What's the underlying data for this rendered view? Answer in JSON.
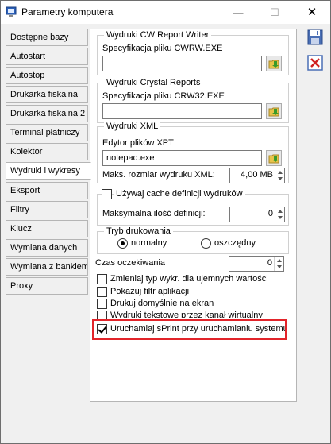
{
  "window": {
    "title": "Parametry komputera"
  },
  "titlebar": {
    "minimize": "—",
    "maximize": "☐",
    "close": "✕"
  },
  "sidebar": {
    "items": [
      {
        "label": "Dostępne bazy"
      },
      {
        "label": "Autostart"
      },
      {
        "label": "Autostop"
      },
      {
        "label": "Drukarka fiskalna"
      },
      {
        "label": "Drukarka fiskalna 2"
      },
      {
        "label": "Terminal płatniczy"
      },
      {
        "label": "Kolektor"
      },
      {
        "label": "Wydruki i wykresy",
        "active": true
      },
      {
        "label": "Eksport"
      },
      {
        "label": "Filtry"
      },
      {
        "label": "Klucz"
      },
      {
        "label": "Wymiana danych"
      },
      {
        "label": "Wymiana z bankiem"
      },
      {
        "label": "Proxy"
      }
    ]
  },
  "cw": {
    "title": "Wydruki CW Report Writer",
    "label": "Specyfikacja pliku CWRW.EXE",
    "value": ""
  },
  "crystal": {
    "title": "Wydruki Crystal Reports",
    "label": "Specyfikacja pliku CRW32.EXE",
    "value": ""
  },
  "xml": {
    "title": "Wydruki XML",
    "editor_label": "Edytor plików XPT",
    "editor_value": "notepad.exe",
    "max_label": "Maks. rozmiar wydruku XML:",
    "max_value": "4,00 MB"
  },
  "cache": {
    "label": "Używaj cache definicji wydruków",
    "checked": false,
    "max_label": "Maksymalna ilość definicji:",
    "max_value": "0"
  },
  "mode": {
    "title": "Tryb drukowania",
    "normal": "normalny",
    "saving": "oszczędny",
    "selected": "normalny"
  },
  "timeout": {
    "label": "Czas oczekiwania",
    "value": "0"
  },
  "options": [
    {
      "label": "Zmieniaj typ wykr. dla ujemnych wartości",
      "checked": false
    },
    {
      "label": "Pokazuj filtr aplikacji",
      "checked": false
    },
    {
      "label": "Drukuj domyślnie na ekran",
      "checked": false
    },
    {
      "label": "Wydruki tekstowe przez kanał wirtualny",
      "checked": false
    },
    {
      "label": "Uruchamiaj sPrint przy uruchamianiu systemu",
      "checked": true
    }
  ],
  "colors": {
    "highlight": "#e2242a",
    "folder_icon": "#e8c34a",
    "arrow": "#3a9a2a",
    "save_icon": "#4a6fb5",
    "cancel_icon": "#d02020"
  }
}
